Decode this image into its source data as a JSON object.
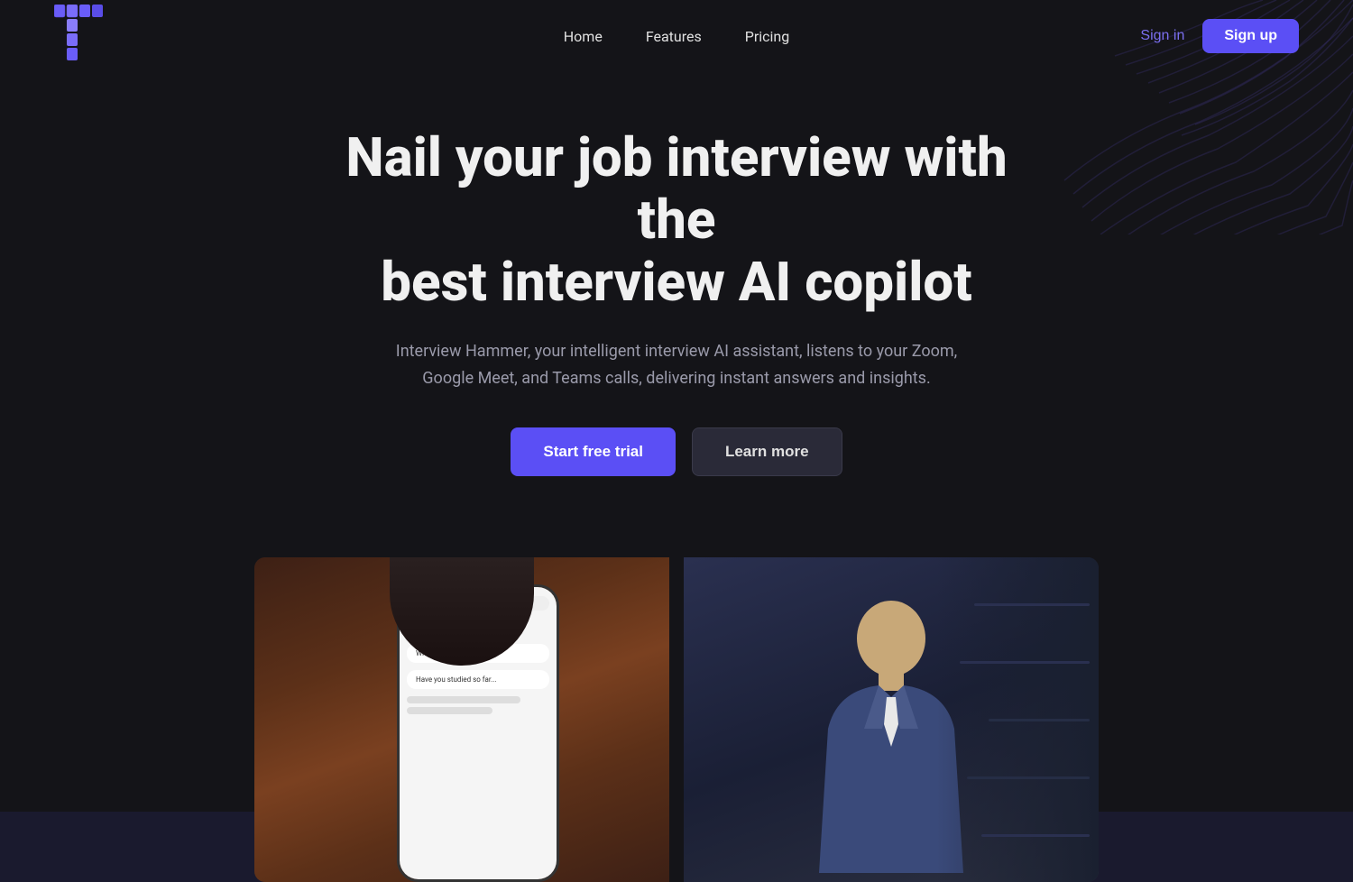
{
  "nav": {
    "links": [
      {
        "label": "Home",
        "id": "home"
      },
      {
        "label": "Features",
        "id": "features"
      },
      {
        "label": "Pricing",
        "id": "pricing"
      }
    ],
    "signin_label": "Sign in",
    "signup_label": "Sign up"
  },
  "hero": {
    "title_line1": "Nail your job interview with the",
    "title_line2": "best interview AI copilot",
    "subtitle": "Interview Hammer, your intelligent interview AI assistant, listens to your Zoom, Google Meet, and Teams calls, delivering instant answers and insights.",
    "cta_primary": "Start free trial",
    "cta_secondary": "Learn more"
  },
  "colors": {
    "accent": "#5b4ff5",
    "signin": "#7b6ff0",
    "bg": "#141418",
    "btn_secondary_bg": "#2a2a38"
  }
}
